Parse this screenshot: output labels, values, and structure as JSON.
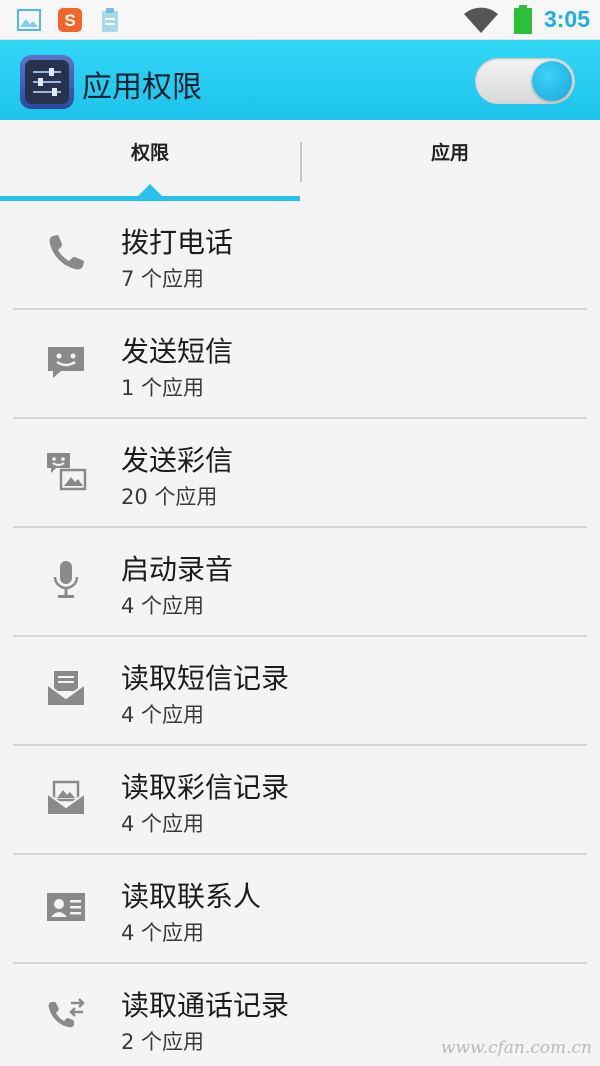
{
  "status_bar": {
    "time": "3:05",
    "icons": [
      "gallery-icon",
      "sogou-icon",
      "clipboard-icon",
      "wifi-icon",
      "battery-icon"
    ],
    "accent_color": "#20aee5"
  },
  "action_bar": {
    "title": "应用权限",
    "toggle_on": true,
    "background_color": "#1ec3ec"
  },
  "tabs": [
    {
      "label": "权限",
      "selected": true
    },
    {
      "label": "应用",
      "selected": false
    }
  ],
  "permissions": [
    {
      "title": "拨打电话",
      "count": "7 个应用",
      "icon": "phone-icon"
    },
    {
      "title": "发送短信",
      "count": "1 个应用",
      "icon": "sms-icon"
    },
    {
      "title": "发送彩信",
      "count": "20 个应用",
      "icon": "mms-icon"
    },
    {
      "title": "启动录音",
      "count": "4 个应用",
      "icon": "microphone-icon"
    },
    {
      "title": "读取短信记录",
      "count": "4 个应用",
      "icon": "sms-inbox-icon"
    },
    {
      "title": "读取彩信记录",
      "count": "4 个应用",
      "icon": "mms-inbox-icon"
    },
    {
      "title": "读取联系人",
      "count": "4 个应用",
      "icon": "contact-card-icon"
    },
    {
      "title": "读取通话记录",
      "count": "2 个应用",
      "icon": "call-log-icon"
    }
  ],
  "watermark": "www.cfan.com.cn"
}
